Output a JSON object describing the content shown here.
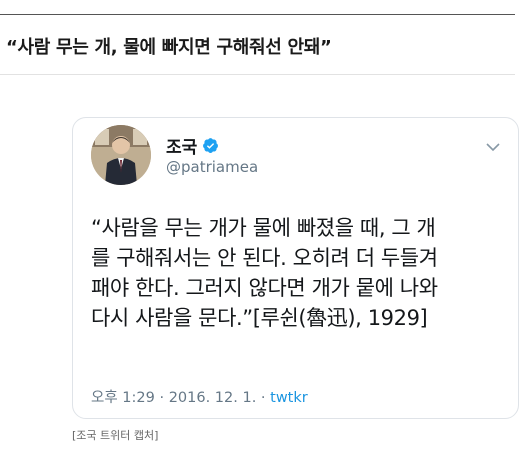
{
  "article": {
    "headline": "“사람 무는 개, 물에 빠지면 구해줘선 안돼”",
    "caption": "[조국 트위터 캡처]"
  },
  "tweet": {
    "author_name": "조국",
    "handle": "@patriamea",
    "verified": true,
    "text_lines": [
      "“사람을 무는 개가 물에 빠졌을 때, 그 개",
      "를 구해줘서는 안 된다. 오히려 더 두들겨",
      "패야 한다. 그러지 않다면 개가 뭍에 나와",
      "다시 사람을 문다.”[루쉰(魯迅), 1929]"
    ],
    "time": "오후 1:29",
    "date": "2016. 12. 1.",
    "separator": "·",
    "source": "twtkr",
    "icons": {
      "avatar": "profile-photo",
      "verified": "verified-badge-icon",
      "menu": "chevron-down-icon"
    },
    "colors": {
      "verified": "#1da1f2",
      "link": "#1b95e0",
      "meta": "#657786"
    }
  }
}
